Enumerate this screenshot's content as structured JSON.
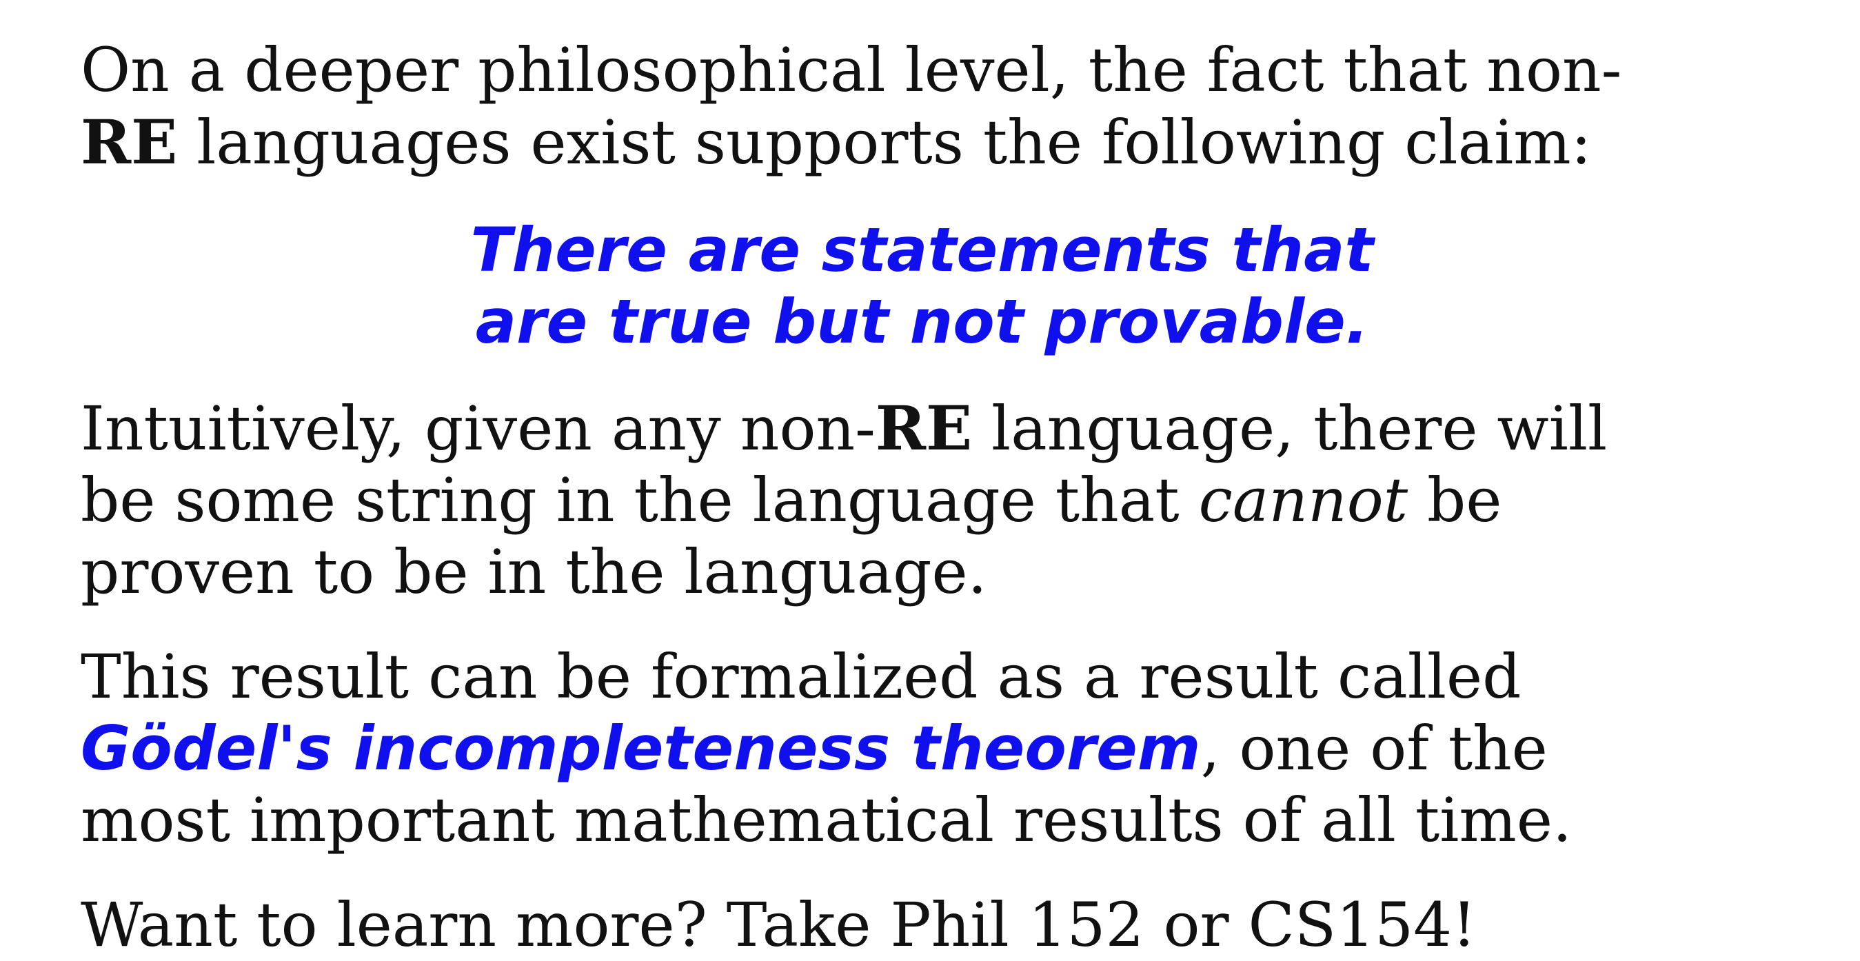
{
  "paragraph1": {
    "line1": "On a deeper philosophical level, the fact that non-",
    "line2_bold": "RE",
    "line2_rest": " languages exist supports the following claim:"
  },
  "quote": {
    "line1": "There are statements that",
    "line2": "are true but not provable."
  },
  "paragraph2": {
    "line1_pre": "Intuitively, given any non-",
    "line1_bold": "RE",
    "line1_post": " language, there will",
    "line2_pre": "be some string in the language that ",
    "line2_italic": "cannot",
    "line2_post": " be",
    "line3": "proven to be in the language."
  },
  "paragraph3": {
    "line1": "This result can be formalized as a result called",
    "line2_term": "Gödel's incompleteness theorem",
    "line2_post": ", one of the",
    "line3": "most important mathematical results of all time."
  },
  "paragraph4": {
    "line1": "Want to learn more? Take Phil 152 or CS154!"
  }
}
